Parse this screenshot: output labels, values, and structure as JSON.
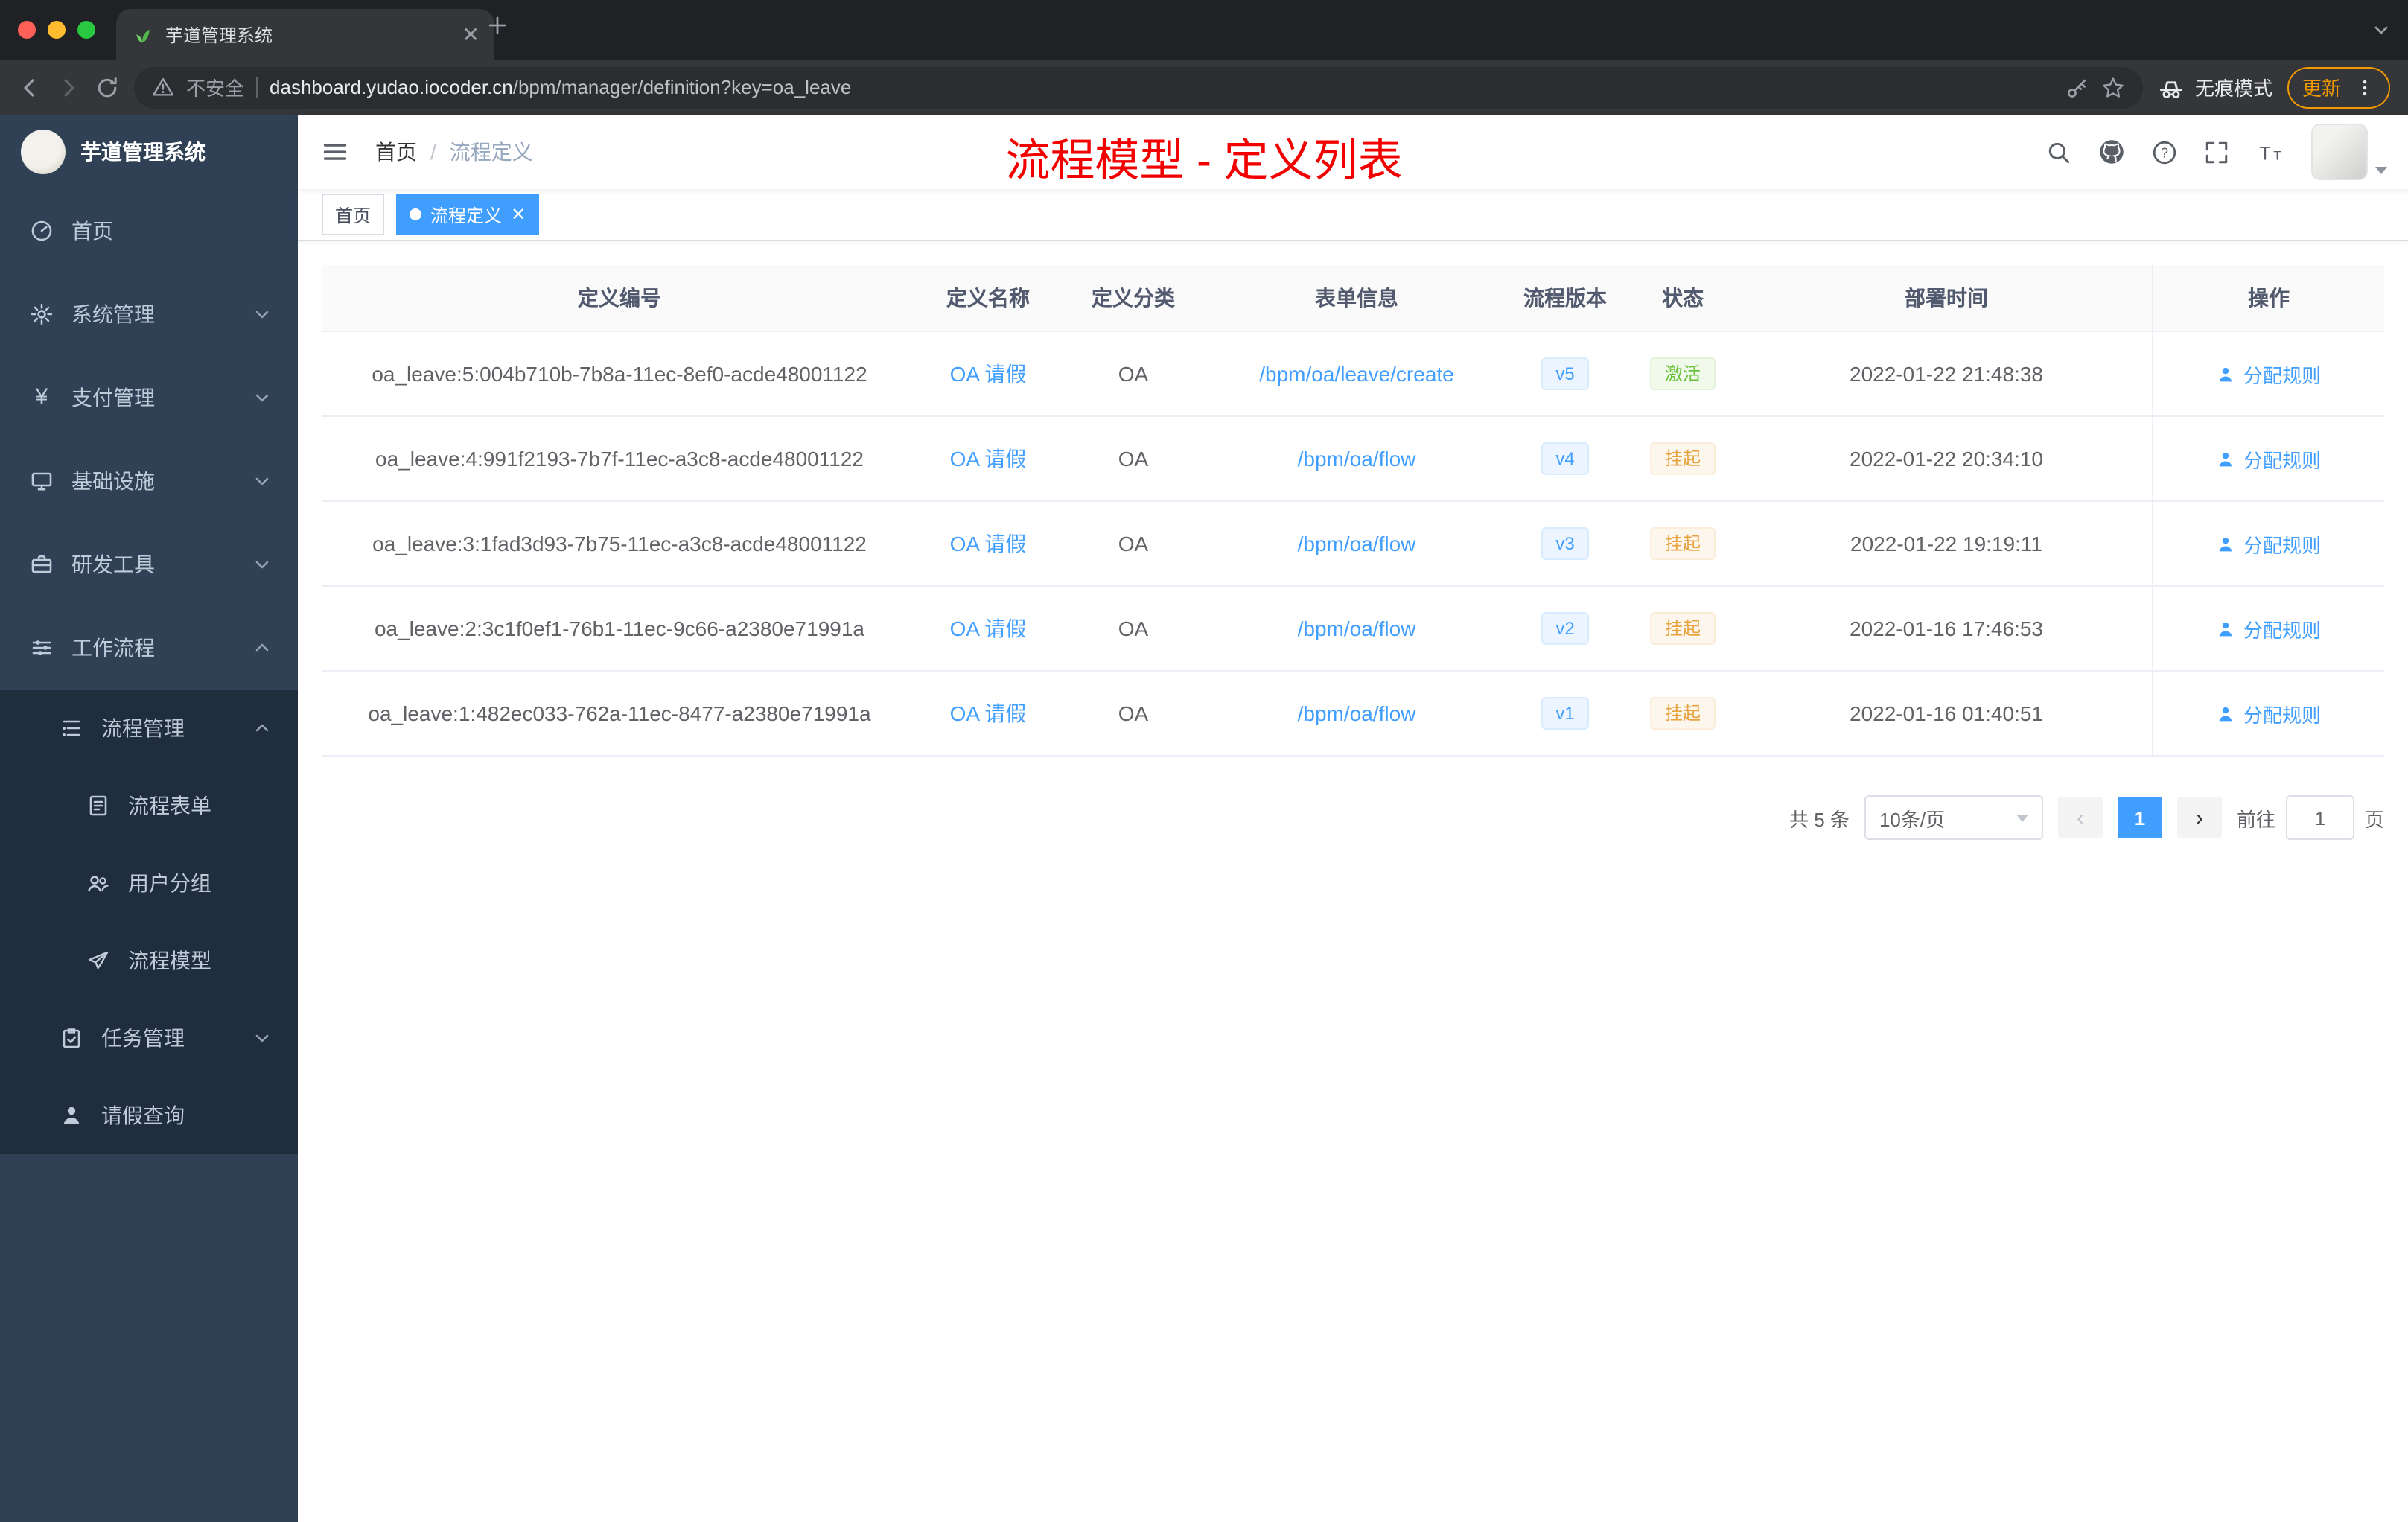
{
  "browser": {
    "tab_title": "芋道管理系统",
    "security_label": "不安全",
    "url_host": "dashboard.yudao.iocoder.cn",
    "url_path": "/bpm/manager/definition?key=oa_leave",
    "incognito_label": "无痕模式",
    "update_label": "更新"
  },
  "sidebar": {
    "logo_title": "芋道管理系统",
    "items": [
      {
        "label": "首页"
      },
      {
        "label": "系统管理"
      },
      {
        "label": "支付管理"
      },
      {
        "label": "基础设施"
      },
      {
        "label": "研发工具"
      },
      {
        "label": "工作流程",
        "children": [
          {
            "label": "流程管理",
            "children": [
              {
                "label": "流程表单"
              },
              {
                "label": "用户分组"
              },
              {
                "label": "流程模型"
              }
            ]
          },
          {
            "label": "任务管理"
          },
          {
            "label": "请假查询"
          }
        ]
      }
    ]
  },
  "header": {
    "breadcrumb_home": "首页",
    "breadcrumb_current": "流程定义",
    "annotation": "流程模型 - 定义列表"
  },
  "tags": [
    {
      "label": "首页",
      "active": false
    },
    {
      "label": "流程定义",
      "active": true
    }
  ],
  "table": {
    "columns": [
      "定义编号",
      "定义名称",
      "定义分类",
      "表单信息",
      "流程版本",
      "状态",
      "部署时间",
      "操作"
    ],
    "rows": [
      {
        "id": "oa_leave:5:004b710b-7b8a-11ec-8ef0-acde48001122",
        "name": "OA 请假",
        "category": "OA",
        "form": "/bpm/oa/leave/create",
        "version": "v5",
        "status": "激活",
        "time": "2022-01-22 21:48:38",
        "action": "分配规则"
      },
      {
        "id": "oa_leave:4:991f2193-7b7f-11ec-a3c8-acde48001122",
        "name": "OA 请假",
        "category": "OA",
        "form": "/bpm/oa/flow",
        "version": "v4",
        "status": "挂起",
        "time": "2022-01-22 20:34:10",
        "action": "分配规则"
      },
      {
        "id": "oa_leave:3:1fad3d93-7b75-11ec-a3c8-acde48001122",
        "name": "OA 请假",
        "category": "OA",
        "form": "/bpm/oa/flow",
        "version": "v3",
        "status": "挂起",
        "time": "2022-01-22 19:19:11",
        "action": "分配规则"
      },
      {
        "id": "oa_leave:2:3c1f0ef1-76b1-11ec-9c66-a2380e71991a",
        "name": "OA 请假",
        "category": "OA",
        "form": "/bpm/oa/flow",
        "version": "v2",
        "status": "挂起",
        "time": "2022-01-16 17:46:53",
        "action": "分配规则"
      },
      {
        "id": "oa_leave:1:482ec033-762a-11ec-8477-a2380e71991a",
        "name": "OA 请假",
        "category": "OA",
        "form": "/bpm/oa/flow",
        "version": "v1",
        "status": "挂起",
        "time": "2022-01-16 01:40:51",
        "action": "分配规则"
      }
    ]
  },
  "pagination": {
    "total": "共 5 条",
    "page_size": "10条/页",
    "current_page": "1",
    "goto_label": "前往",
    "goto_suffix": "页",
    "goto_value": "1"
  }
}
